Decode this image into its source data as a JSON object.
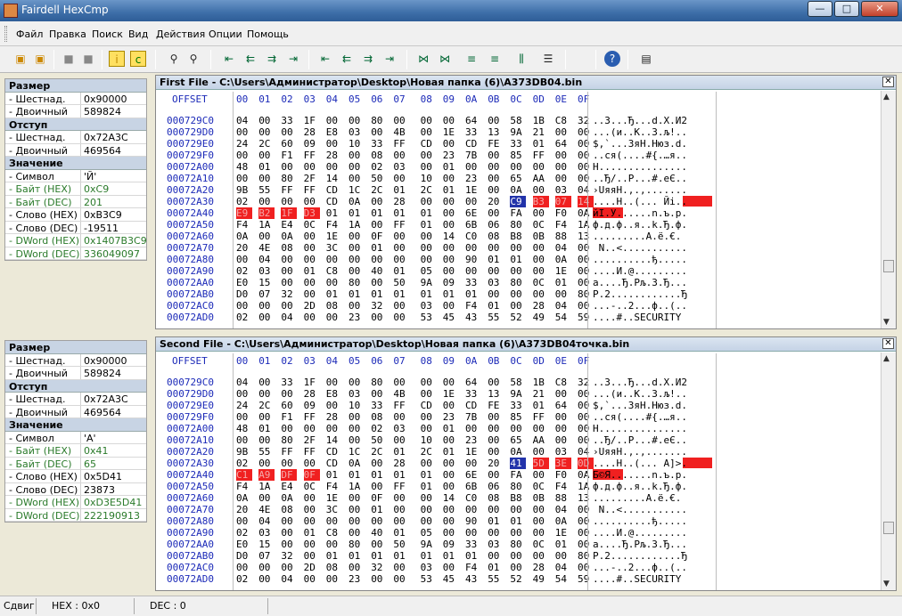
{
  "window": {
    "title": "Fairdell HexCmp",
    "minimize": "—",
    "maximize": "□",
    "close": "✕"
  },
  "menu": [
    "Файл",
    "Правка",
    "Поиск",
    "Вид",
    "Действия",
    "Опции",
    "Помощь"
  ],
  "props_left_labels": {
    "razmer": "Размер",
    "otstup": "Отступ",
    "znachenie": "Значение"
  },
  "props1": [
    {
      "k": "Размер",
      "hdr": true
    },
    {
      "k": "- Шестнад.",
      "v": "0x90000"
    },
    {
      "k": "- Двоичный",
      "v": "589824"
    },
    {
      "k": "Отступ",
      "hdr": true
    },
    {
      "k": "- Шестнад.",
      "v": "0x72A3C"
    },
    {
      "k": "- Двоичный",
      "v": "469564"
    },
    {
      "k": "Значение",
      "hdr": true
    },
    {
      "k": "- Символ",
      "v": "'Й'"
    },
    {
      "k": "- Байт (HEX)",
      "v": "0xC9",
      "green": true
    },
    {
      "k": "- Байт (DEC)",
      "v": "201",
      "green": true
    },
    {
      "k": "- Слово (HEX)",
      "v": "0xB3C9"
    },
    {
      "k": "- Слово (DEC)",
      "v": "-19511"
    },
    {
      "k": "- DWord (HEX)",
      "v": "0x1407B3C9",
      "green": true
    },
    {
      "k": "- DWord (DEC)",
      "v": "336049097",
      "green": true
    }
  ],
  "props2": [
    {
      "k": "Размер",
      "hdr": true
    },
    {
      "k": "- Шестнад.",
      "v": "0x90000"
    },
    {
      "k": "- Двоичный",
      "v": "589824"
    },
    {
      "k": "Отступ",
      "hdr": true
    },
    {
      "k": "- Шестнад.",
      "v": "0x72A3C"
    },
    {
      "k": "- Двоичный",
      "v": "469564"
    },
    {
      "k": "Значение",
      "hdr": true
    },
    {
      "k": "- Символ",
      "v": "'A'"
    },
    {
      "k": "- Байт (HEX)",
      "v": "0x41",
      "green": true
    },
    {
      "k": "- Байт (DEC)",
      "v": "65",
      "green": true
    },
    {
      "k": "- Слово (HEX)",
      "v": "0x5D41"
    },
    {
      "k": "- Слово (DEC)",
      "v": "23873"
    },
    {
      "k": "- DWord (HEX)",
      "v": "0xD3E5D41",
      "green": true
    },
    {
      "k": "- DWord (DEC)",
      "v": "222190913",
      "green": true
    }
  ],
  "hex_columns": [
    "00",
    "01",
    "02",
    "03",
    "04",
    "05",
    "06",
    "07",
    "08",
    "09",
    "0A",
    "0B",
    "0C",
    "0D",
    "0E",
    "0F"
  ],
  "offset_label": "OFFSET",
  "panel1": {
    "title": "First File - C:\\Users\\Администратор\\Desktop\\Новая папка (6)\\A373DB04.bin",
    "rows": [
      {
        "o": "000729C0",
        "b": [
          "04",
          "00",
          "33",
          "1F",
          "00",
          "00",
          "80",
          "00",
          "00",
          "00",
          "64",
          "00",
          "58",
          "1B",
          "C8",
          "32"
        ],
        "a": "..3...Ђ...d.X.И2"
      },
      {
        "o": "000729D0",
        "b": [
          "00",
          "00",
          "00",
          "28",
          "E8",
          "03",
          "00",
          "4B",
          "00",
          "1E",
          "33",
          "13",
          "9A",
          "21",
          "00",
          "00"
        ],
        "a": "...(и..K..3.љ!.."
      },
      {
        "o": "000729E0",
        "b": [
          "24",
          "2C",
          "60",
          "09",
          "00",
          "10",
          "33",
          "FF",
          "CD",
          "00",
          "CD",
          "FE",
          "33",
          "01",
          "64",
          "00"
        ],
        "a": "$,`...3яН.Нюз.d."
      },
      {
        "o": "000729F0",
        "b": [
          "00",
          "00",
          "F1",
          "FF",
          "28",
          "00",
          "08",
          "00",
          "00",
          "23",
          "7B",
          "00",
          "85",
          "FF",
          "00",
          "00"
        ],
        "a": "..ся(....#{.…я.."
      },
      {
        "o": "00072A00",
        "b": [
          "48",
          "01",
          "00",
          "00",
          "00",
          "00",
          "02",
          "03",
          "00",
          "01",
          "00",
          "00",
          "00",
          "00",
          "00",
          "00"
        ],
        "a": "H..............."
      },
      {
        "o": "00072A10",
        "b": [
          "00",
          "00",
          "80",
          "2F",
          "14",
          "00",
          "50",
          "00",
          "10",
          "00",
          "23",
          "00",
          "65",
          "AA",
          "00",
          "00"
        ],
        "a": "..Ђ/..P...#.eЄ.."
      },
      {
        "o": "00072A20",
        "b": [
          "9B",
          "55",
          "FF",
          "FF",
          "CD",
          "1C",
          "2C",
          "01",
          "2C",
          "01",
          "1E",
          "00",
          "0A",
          "00",
          "03",
          "04"
        ],
        "a": "›UяяН.,.,......."
      },
      {
        "o": "00072A30",
        "b": [
          "02",
          "00",
          "00",
          "00",
          "CD",
          "0A",
          "00",
          "28",
          "00",
          "00",
          "00",
          "20",
          "C9",
          "B3",
          "07",
          "14"
        ],
        "a": "....Н..(... Йі.."
      },
      {
        "o": "00072A40",
        "b": [
          "E9",
          "B2",
          "1F",
          "D3",
          "01",
          "01",
          "01",
          "01",
          "01",
          "00",
          "6E",
          "00",
          "FA",
          "00",
          "F0",
          "0A"
        ],
        "a": "йІ.У......n.ъ.р."
      },
      {
        "o": "00072A50",
        "b": [
          "F4",
          "1A",
          "E4",
          "0C",
          "F4",
          "1A",
          "00",
          "FF",
          "01",
          "00",
          "6B",
          "06",
          "80",
          "0C",
          "F4",
          "1A"
        ],
        "a": "ф.д.ф..я..k.Ђ.ф."
      },
      {
        "o": "00072A60",
        "b": [
          "0A",
          "00",
          "0A",
          "00",
          "1E",
          "00",
          "0F",
          "00",
          "00",
          "14",
          "C0",
          "08",
          "B8",
          "0B",
          "88",
          "13"
        ],
        "a": ".........А.ё.€."
      },
      {
        "o": "00072A70",
        "b": [
          "20",
          "4E",
          "08",
          "00",
          "3C",
          "00",
          "01",
          "00",
          "00",
          "00",
          "00",
          "00",
          "00",
          "00",
          "04",
          "00"
        ],
        "a": " N..<..........."
      },
      {
        "o": "00072A80",
        "b": [
          "00",
          "04",
          "00",
          "00",
          "00",
          "00",
          "00",
          "00",
          "00",
          "00",
          "90",
          "01",
          "01",
          "00",
          "0A",
          "00"
        ],
        "a": "..........ђ....."
      },
      {
        "o": "00072A90",
        "b": [
          "02",
          "03",
          "00",
          "01",
          "C8",
          "00",
          "40",
          "01",
          "05",
          "00",
          "00",
          "00",
          "00",
          "00",
          "1E",
          "00"
        ],
        "a": "....И.@........."
      },
      {
        "o": "00072AA0",
        "b": [
          "E0",
          "15",
          "00",
          "00",
          "00",
          "80",
          "00",
          "50",
          "9A",
          "09",
          "33",
          "03",
          "80",
          "0C",
          "01",
          "00"
        ],
        "a": "а....Ђ.Рљ.3.Ђ..."
      },
      {
        "o": "00072AB0",
        "b": [
          "D0",
          "07",
          "32",
          "00",
          "01",
          "01",
          "01",
          "01",
          "01",
          "01",
          "01",
          "00",
          "00",
          "00",
          "00",
          "80"
        ],
        "a": "Р.2............Ђ"
      },
      {
        "o": "00072AC0",
        "b": [
          "00",
          "00",
          "00",
          "2D",
          "08",
          "00",
          "32",
          "00",
          "03",
          "00",
          "F4",
          "01",
          "00",
          "28",
          "04",
          "00"
        ],
        "a": "...-..2...ф..(.."
      },
      {
        "o": "00072AD0",
        "b": [
          "02",
          "00",
          "04",
          "00",
          "00",
          "23",
          "00",
          "00",
          "53",
          "45",
          "43",
          "55",
          "52",
          "49",
          "54",
          "59"
        ],
        "a": "....#..SECURITY"
      }
    ]
  },
  "panel2": {
    "title": "Second File - C:\\Users\\Администратор\\Desktop\\Новая папка (6)\\A373DB04точка.bin",
    "rows": [
      {
        "o": "000729C0",
        "b": [
          "04",
          "00",
          "33",
          "1F",
          "00",
          "00",
          "80",
          "00",
          "00",
          "00",
          "64",
          "00",
          "58",
          "1B",
          "C8",
          "32"
        ],
        "a": "..3...Ђ...d.X.И2"
      },
      {
        "o": "000729D0",
        "b": [
          "00",
          "00",
          "00",
          "28",
          "E8",
          "03",
          "00",
          "4B",
          "00",
          "1E",
          "33",
          "13",
          "9A",
          "21",
          "00",
          "00"
        ],
        "a": "...(и..K..3.љ!.."
      },
      {
        "o": "000729E0",
        "b": [
          "24",
          "2C",
          "60",
          "09",
          "00",
          "10",
          "33",
          "FF",
          "CD",
          "00",
          "CD",
          "FE",
          "33",
          "01",
          "64",
          "00"
        ],
        "a": "$,`...3яН.Нюз.d."
      },
      {
        "o": "000729F0",
        "b": [
          "00",
          "00",
          "F1",
          "FF",
          "28",
          "00",
          "08",
          "00",
          "00",
          "23",
          "7B",
          "00",
          "85",
          "FF",
          "00",
          "00"
        ],
        "a": "..ся(....#{.…я.."
      },
      {
        "o": "00072A00",
        "b": [
          "48",
          "01",
          "00",
          "00",
          "00",
          "00",
          "02",
          "03",
          "00",
          "01",
          "00",
          "00",
          "00",
          "00",
          "00",
          "00"
        ],
        "a": "H..............."
      },
      {
        "o": "00072A10",
        "b": [
          "00",
          "00",
          "80",
          "2F",
          "14",
          "00",
          "50",
          "00",
          "10",
          "00",
          "23",
          "00",
          "65",
          "AA",
          "00",
          "00"
        ],
        "a": "..Ђ/..P...#.eЄ.."
      },
      {
        "o": "00072A20",
        "b": [
          "9B",
          "55",
          "FF",
          "FF",
          "CD",
          "1C",
          "2C",
          "01",
          "2C",
          "01",
          "1E",
          "00",
          "0A",
          "00",
          "03",
          "04"
        ],
        "a": "›UяяН.,.,......."
      },
      {
        "o": "00072A30",
        "b": [
          "02",
          "00",
          "00",
          "00",
          "CD",
          "0A",
          "00",
          "28",
          "00",
          "00",
          "00",
          "20",
          "41",
          "5D",
          "3E",
          "0D"
        ],
        "a": "....Н..(... A]>."
      },
      {
        "o": "00072A40",
        "b": [
          "C1",
          "A9",
          "DF",
          "0F",
          "01",
          "01",
          "01",
          "01",
          "01",
          "00",
          "6E",
          "00",
          "FA",
          "00",
          "F0",
          "0A"
        ],
        "a": "Б©Я.......n.ъ.р."
      },
      {
        "o": "00072A50",
        "b": [
          "F4",
          "1A",
          "E4",
          "0C",
          "F4",
          "1A",
          "00",
          "FF",
          "01",
          "00",
          "6B",
          "06",
          "80",
          "0C",
          "F4",
          "1A"
        ],
        "a": "ф.д.ф..я..k.Ђ.ф."
      },
      {
        "o": "00072A60",
        "b": [
          "0A",
          "00",
          "0A",
          "00",
          "1E",
          "00",
          "0F",
          "00",
          "00",
          "14",
          "C0",
          "08",
          "B8",
          "0B",
          "88",
          "13"
        ],
        "a": ".........А.ё.€."
      },
      {
        "o": "00072A70",
        "b": [
          "20",
          "4E",
          "08",
          "00",
          "3C",
          "00",
          "01",
          "00",
          "00",
          "00",
          "00",
          "00",
          "00",
          "00",
          "04",
          "00"
        ],
        "a": " N..<..........."
      },
      {
        "o": "00072A80",
        "b": [
          "00",
          "04",
          "00",
          "00",
          "00",
          "00",
          "00",
          "00",
          "00",
          "00",
          "90",
          "01",
          "01",
          "00",
          "0A",
          "00"
        ],
        "a": "..........ђ....."
      },
      {
        "o": "00072A90",
        "b": [
          "02",
          "03",
          "00",
          "01",
          "C8",
          "00",
          "40",
          "01",
          "05",
          "00",
          "00",
          "00",
          "00",
          "00",
          "1E",
          "00"
        ],
        "a": "....И.@........."
      },
      {
        "o": "00072AA0",
        "b": [
          "E0",
          "15",
          "00",
          "00",
          "00",
          "80",
          "00",
          "50",
          "9A",
          "09",
          "33",
          "03",
          "80",
          "0C",
          "01",
          "00"
        ],
        "a": "а....Ђ.Рљ.3.Ђ..."
      },
      {
        "o": "00072AB0",
        "b": [
          "D0",
          "07",
          "32",
          "00",
          "01",
          "01",
          "01",
          "01",
          "01",
          "01",
          "01",
          "00",
          "00",
          "00",
          "00",
          "80"
        ],
        "a": "Р.2............Ђ"
      },
      {
        "o": "00072AC0",
        "b": [
          "00",
          "00",
          "00",
          "2D",
          "08",
          "00",
          "32",
          "00",
          "03",
          "00",
          "F4",
          "01",
          "00",
          "28",
          "04",
          "00"
        ],
        "a": "...-..2...ф..(.."
      },
      {
        "o": "00072AD0",
        "b": [
          "02",
          "00",
          "04",
          "00",
          "00",
          "23",
          "00",
          "00",
          "53",
          "45",
          "43",
          "55",
          "52",
          "49",
          "54",
          "59"
        ],
        "a": "....#..SECURITY"
      }
    ]
  },
  "status": {
    "mode": "Сдвиг",
    "hex": "HEX : 0x0",
    "dec": "DEC : 0"
  },
  "colors": {
    "diff": "#f02020",
    "cursor": "#2233aa",
    "offset_text": "#1c2ab8",
    "green_text": "#2a7a2a"
  }
}
